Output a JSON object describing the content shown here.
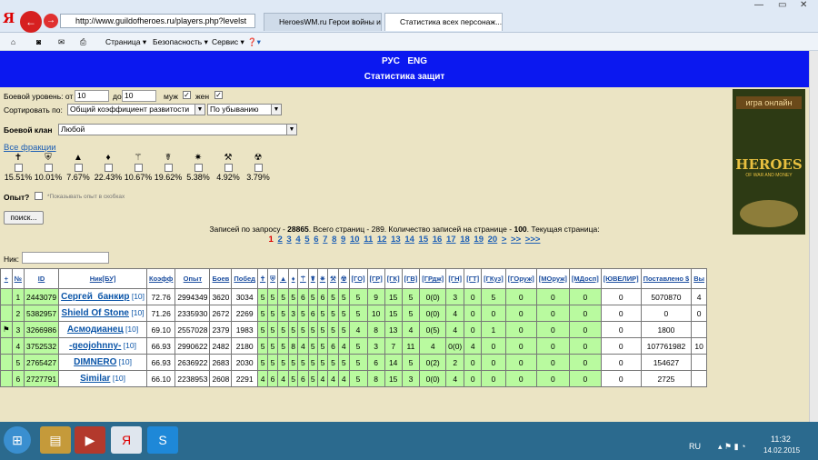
{
  "browser": {
    "url": "http://www.guildofheroes.ru/players.php?levelst",
    "tabs": [
      "HeroesWM.ru Герои войны и ...",
      "Статистика всех персонаж..."
    ],
    "menu": [
      "Страница ▾",
      "Безопасность ▾",
      "Сервис ▾"
    ]
  },
  "header": {
    "lang_ru": "РУС",
    "lang_en": "ENG",
    "title": "Статистика защит"
  },
  "filters": {
    "level_label": "Боевой уровень: от",
    "level_from": "10",
    "level_to_label": "до",
    "level_to": "10",
    "male": "муж",
    "female": "жен",
    "sort_label": "Сортировать по:",
    "sort_value": "Общий коэффициент развитости",
    "order_value": "По убыванию",
    "clan_label": "Боевой клан",
    "clan_value": "Любой",
    "all_factions": "Все фракции",
    "exp_label": "Опыт?",
    "exp_hint": "*Показывать опыт в скобках",
    "search_button": "поиск...",
    "nick_label": "Ник:"
  },
  "factions": [
    {
      "icon": "✝",
      "pct": "15.51%"
    },
    {
      "icon": "⛨",
      "pct": "10.01%"
    },
    {
      "icon": "▲",
      "pct": "7.67%"
    },
    {
      "icon": "♦",
      "pct": "22.43%"
    },
    {
      "icon": "⚚",
      "pct": "10.67%"
    },
    {
      "icon": "☤",
      "pct": "19.62%"
    },
    {
      "icon": "✷",
      "pct": "5.38%"
    },
    {
      "icon": "⚒",
      "pct": "4.92%"
    },
    {
      "icon": "☢",
      "pct": "3.79%"
    }
  ],
  "summary": {
    "text_a": "Записей по запросу - ",
    "total": "28865",
    "text_b": ". Всего страниц - 289. Количество записей на странице - ",
    "per_page": "100",
    "text_c": ". Текущая страница:"
  },
  "pages": [
    "1",
    "2",
    "3",
    "4",
    "5",
    "6",
    "7",
    "8",
    "9",
    "10",
    "11",
    "12",
    "13",
    "14",
    "15",
    "16",
    "17",
    "18",
    "19",
    "20",
    ">",
    ">>",
    ">>>"
  ],
  "ad": {
    "line1": "игра онлайн",
    "line2": "HEROES",
    "line3": "OF WAR AND MONEY"
  },
  "table": {
    "headers": [
      "+",
      "№",
      "ID",
      "Ник[БУ]",
      "Коэфф",
      "Опыт",
      "Боев",
      "Побед",
      "✝",
      "⛨",
      "▲",
      "♦",
      "⚚",
      "☤",
      "✷",
      "⚒",
      "☢",
      "[ГО]",
      "[ГР]",
      "[ГК]",
      "[ГВ]",
      "[ГРдж]",
      "[ГН]",
      "[ГТ]",
      "[ГКуз]",
      "[ГОруж]",
      "[МОруж]",
      "[МДосп]",
      "[ЮВЕЛИР]",
      "Поставлено $",
      "Вы"
    ],
    "rows": [
      {
        "mark": "",
        "n": "1",
        "id": "2443079",
        "nick": "Сергей_банкир",
        "lvl": "[10]",
        "k": "72.76",
        "exp": "2994349",
        "b": "3620",
        "w": "3034",
        "f": [
          "5",
          "5",
          "5",
          "5",
          "6",
          "5",
          "6",
          "5",
          "5"
        ],
        "g": [
          "5",
          "9",
          "15",
          "5",
          "0(0)",
          "3",
          "0",
          "5",
          "0",
          "0",
          "0",
          "0",
          "5070870",
          "4"
        ]
      },
      {
        "mark": "",
        "n": "2",
        "id": "5382957",
        "nick": "Shield Of Stone",
        "lvl": "[10]",
        "k": "71.26",
        "exp": "2335930",
        "b": "2672",
        "w": "2269",
        "f": [
          "5",
          "5",
          "5",
          "3",
          "5",
          "6",
          "5",
          "5",
          "5"
        ],
        "g": [
          "5",
          "10",
          "15",
          "5",
          "0(0)",
          "4",
          "0",
          "0",
          "0",
          "0",
          "0",
          "0",
          "0",
          "0"
        ]
      },
      {
        "mark": "⚑",
        "n": "3",
        "id": "3266986",
        "nick": "Асмодианец",
        "lvl": "[10]",
        "k": "69.10",
        "exp": "2557028",
        "b": "2379",
        "w": "1983",
        "f": [
          "5",
          "5",
          "5",
          "5",
          "5",
          "5",
          "5",
          "5",
          "5"
        ],
        "g": [
          "4",
          "8",
          "13",
          "4",
          "0(5)",
          "4",
          "0",
          "1",
          "0",
          "0",
          "0",
          "0",
          "1800",
          ""
        ]
      },
      {
        "mark": "",
        "n": "4",
        "id": "3752532",
        "nick": "-geojohnny-",
        "lvl": "[10]",
        "k": "66.93",
        "exp": "2990622",
        "b": "2482",
        "w": "2180",
        "f": [
          "5",
          "5",
          "5",
          "8",
          "4",
          "5",
          "5",
          "6",
          "4"
        ],
        "g": [
          "5",
          "3",
          "7",
          "11",
          "4",
          "0(0)",
          "4",
          "0",
          "0",
          "0",
          "0",
          "0",
          "107761982",
          "10"
        ]
      },
      {
        "mark": "",
        "n": "5",
        "id": "2765427",
        "nick": "DIMNERO",
        "lvl": "[10]",
        "k": "66.93",
        "exp": "2636922",
        "b": "2683",
        "w": "2030",
        "f": [
          "5",
          "5",
          "5",
          "5",
          "5",
          "5",
          "5",
          "5",
          "5"
        ],
        "g": [
          "5",
          "6",
          "14",
          "5",
          "0(2)",
          "2",
          "0",
          "0",
          "0",
          "0",
          "0",
          "0",
          "154627",
          ""
        ]
      },
      {
        "mark": "",
        "n": "6",
        "id": "2727791",
        "nick": "Similar",
        "lvl": "[10]",
        "k": "66.10",
        "exp": "2238953",
        "b": "2608",
        "w": "2291",
        "f": [
          "4",
          "6",
          "4",
          "5",
          "6",
          "5",
          "4",
          "4",
          "4"
        ],
        "g": [
          "5",
          "8",
          "15",
          "3",
          "0(0)",
          "4",
          "0",
          "0",
          "0",
          "0",
          "0",
          "0",
          "2725",
          ""
        ]
      }
    ]
  },
  "taskbar": {
    "lang": "RU",
    "time": "11:32",
    "date": "14.02.2015"
  },
  "colors": {
    "blue_bar": "#0b18f0",
    "row_green": "#b9fa9f",
    "page_bg": "#ebe4c4"
  }
}
